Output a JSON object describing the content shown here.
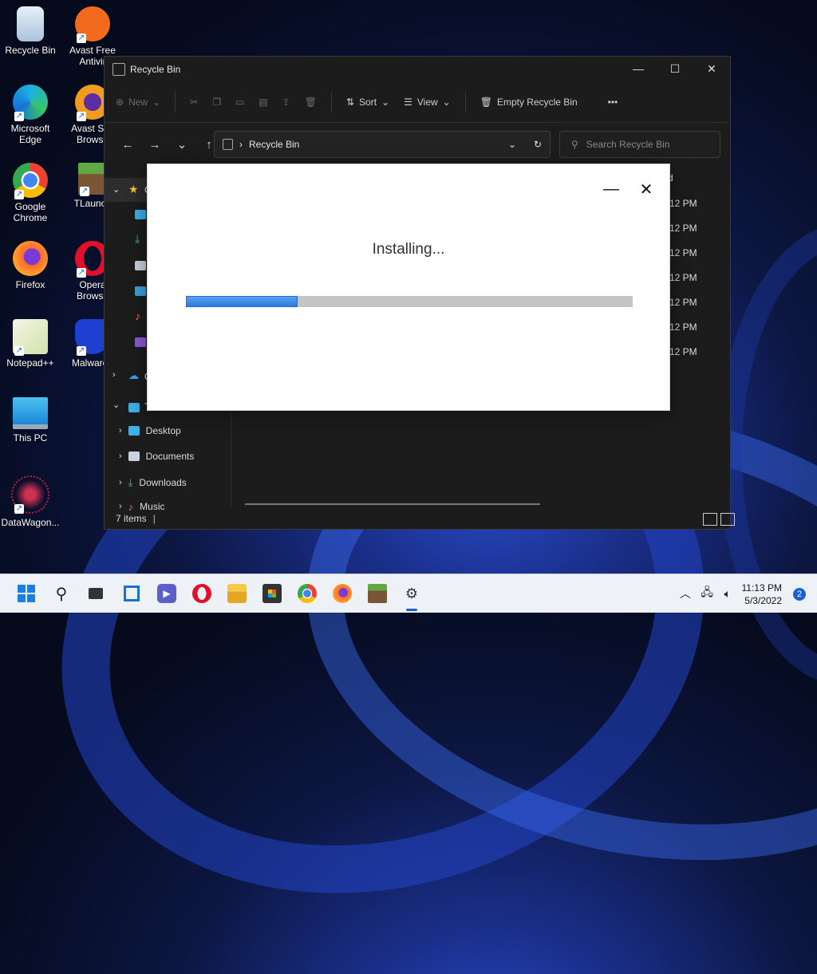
{
  "desktop": {
    "icons": [
      {
        "label": "Recycle Bin",
        "icon": "recycle-bin-icon"
      },
      {
        "label": "Avast Free Antivir",
        "icon": "avast-icon"
      },
      {
        "label": "Microsoft Edge",
        "icon": "edge-icon"
      },
      {
        "label": "Avast Sec Browse",
        "icon": "avast-secure-browser-icon"
      },
      {
        "label": "Google Chrome",
        "icon": "chrome-icon"
      },
      {
        "label": "TLaunch",
        "icon": "tlauncher-icon"
      },
      {
        "label": "Firefox",
        "icon": "firefox-icon"
      },
      {
        "label": "Opera Browse",
        "icon": "opera-icon"
      },
      {
        "label": "Notepad++",
        "icon": "notepadpp-icon"
      },
      {
        "label": "Malwareb",
        "icon": "malwarebytes-icon"
      },
      {
        "label": "This PC",
        "icon": "this-pc-icon"
      },
      {
        "label": "DataWagon...",
        "icon": "datawagon-icon"
      }
    ]
  },
  "explorer": {
    "title": "Recycle Bin",
    "toolbar": {
      "new_label": "New",
      "sort_label": "Sort",
      "view_label": "View",
      "empty_label": "Empty Recycle Bin",
      "more_label": "•••"
    },
    "address": {
      "path": "Recycle Bin",
      "separator": "›"
    },
    "search_placeholder": "Search Recycle Bin",
    "column_fragment": "d",
    "times": [
      "12 PM",
      "12 PM",
      "12 PM",
      "12 PM",
      "12 PM",
      "12 PM",
      "12 PM"
    ],
    "nav": {
      "quick_access_fragment": "C",
      "onedrive_fragment": "O",
      "thispc_fragment": "T",
      "items": [
        {
          "label": "Desktop"
        },
        {
          "label": "Documents"
        },
        {
          "label": "Downloads"
        },
        {
          "label": "Music"
        }
      ]
    },
    "status": {
      "items_count": "7 items",
      "divider": "|"
    }
  },
  "installer": {
    "title": "Installing...",
    "progress": 0.25
  },
  "taskbar": {
    "clock_time": "11:13 PM",
    "clock_date": "5/3/2022",
    "notification_count": "2"
  },
  "colors": {
    "accent": "#1a5fd6",
    "progress_fill": "#3b86e6",
    "progress_track": "#c4c4c4",
    "window_bg": "#1c1c1c"
  }
}
